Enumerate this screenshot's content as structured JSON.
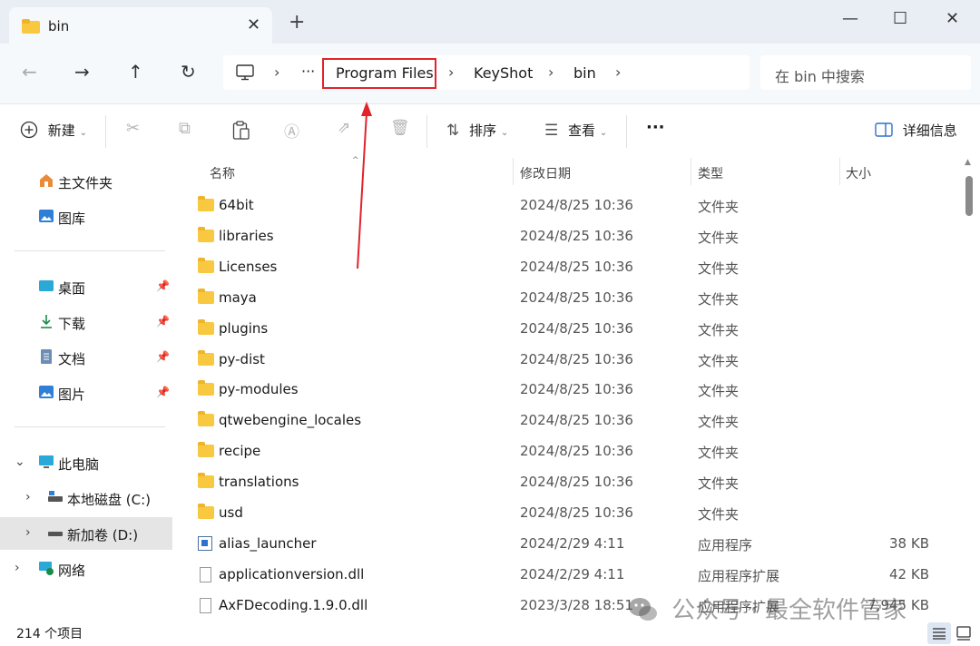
{
  "window": {
    "tab_title": "bin",
    "tab_close": "✕",
    "new_tab": "+",
    "minimize": "—",
    "maximize": "☐",
    "close": "✕"
  },
  "nav": {
    "back": "←",
    "forward": "→",
    "up": "↑",
    "refresh": "↻",
    "breadcrumb": [
      "Program Files",
      "KeyShot",
      "bin"
    ],
    "overflow": "···",
    "search_placeholder": "在 bin 中搜索"
  },
  "toolbar": {
    "new_label": "新建",
    "sort_label": "排序",
    "view_label": "查看",
    "more": "···",
    "details_label": "详细信息"
  },
  "sidebar": {
    "home": "主文件夹",
    "gallery": "图库",
    "quick": [
      {
        "label": "桌面"
      },
      {
        "label": "下载"
      },
      {
        "label": "文档"
      },
      {
        "label": "图片"
      }
    ],
    "this_pc": "此电脑",
    "drives": [
      {
        "label": "本地磁盘 (C:)"
      },
      {
        "label": "新加卷 (D:)"
      }
    ],
    "network": "网络"
  },
  "columns": {
    "name": "名称",
    "modified": "修改日期",
    "type": "类型",
    "size": "大小"
  },
  "files": [
    {
      "name": "64bit",
      "date": "2024/8/25 10:36",
      "type": "文件夹",
      "size": "",
      "kind": "folder"
    },
    {
      "name": "libraries",
      "date": "2024/8/25 10:36",
      "type": "文件夹",
      "size": "",
      "kind": "folder"
    },
    {
      "name": "Licenses",
      "date": "2024/8/25 10:36",
      "type": "文件夹",
      "size": "",
      "kind": "folder"
    },
    {
      "name": "maya",
      "date": "2024/8/25 10:36",
      "type": "文件夹",
      "size": "",
      "kind": "folder"
    },
    {
      "name": "plugins",
      "date": "2024/8/25 10:36",
      "type": "文件夹",
      "size": "",
      "kind": "folder"
    },
    {
      "name": "py-dist",
      "date": "2024/8/25 10:36",
      "type": "文件夹",
      "size": "",
      "kind": "folder"
    },
    {
      "name": "py-modules",
      "date": "2024/8/25 10:36",
      "type": "文件夹",
      "size": "",
      "kind": "folder"
    },
    {
      "name": "qtwebengine_locales",
      "date": "2024/8/25 10:36",
      "type": "文件夹",
      "size": "",
      "kind": "folder"
    },
    {
      "name": "recipe",
      "date": "2024/8/25 10:36",
      "type": "文件夹",
      "size": "",
      "kind": "folder"
    },
    {
      "name": "translations",
      "date": "2024/8/25 10:36",
      "type": "文件夹",
      "size": "",
      "kind": "folder"
    },
    {
      "name": "usd",
      "date": "2024/8/25 10:36",
      "type": "文件夹",
      "size": "",
      "kind": "folder"
    },
    {
      "name": "alias_launcher",
      "date": "2024/2/29 4:11",
      "type": "应用程序",
      "size": "38 KB",
      "kind": "exe"
    },
    {
      "name": "applicationversion.dll",
      "date": "2024/2/29 4:11",
      "type": "应用程序扩展",
      "size": "42 KB",
      "kind": "dll"
    },
    {
      "name": "AxFDecoding.1.9.0.dll",
      "date": "2023/3/28 18:51",
      "type": "应用程序扩展",
      "size": "7,945 KB",
      "kind": "dll"
    }
  ],
  "status": {
    "count": "214 个项目"
  },
  "watermark": "公众号 · 最全软件管家",
  "colors": {
    "highlight": "#e0242b",
    "folder": "#f8c840",
    "titlebar": "#e9eef5"
  }
}
